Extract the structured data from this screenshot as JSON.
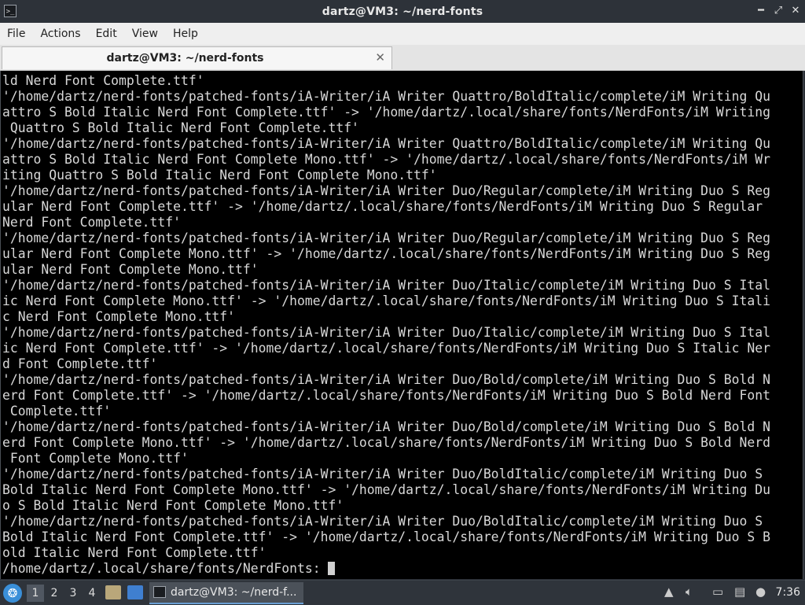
{
  "window": {
    "title": "dartz@VM3: ~/nerd-fonts",
    "controls": {
      "minimize": "━",
      "restore": "⤢",
      "close": "✕"
    },
    "app_icon": ">_"
  },
  "menu": [
    "File",
    "Actions",
    "Edit",
    "View",
    "Help"
  ],
  "tab": {
    "label": "dartz@VM3: ~/nerd-fonts",
    "close": "✕"
  },
  "terminal": {
    "lines": [
      "ld Nerd Font Complete.ttf'",
      "'/home/dartz/nerd-fonts/patched-fonts/iA-Writer/iA Writer Quattro/BoldItalic/complete/iM Writing Qu",
      "attro S Bold Italic Nerd Font Complete.ttf' -> '/home/dartz/.local/share/fonts/NerdFonts/iM Writing",
      " Quattro S Bold Italic Nerd Font Complete.ttf'",
      "'/home/dartz/nerd-fonts/patched-fonts/iA-Writer/iA Writer Quattro/BoldItalic/complete/iM Writing Qu",
      "attro S Bold Italic Nerd Font Complete Mono.ttf' -> '/home/dartz/.local/share/fonts/NerdFonts/iM Wr",
      "iting Quattro S Bold Italic Nerd Font Complete Mono.ttf'",
      "'/home/dartz/nerd-fonts/patched-fonts/iA-Writer/iA Writer Duo/Regular/complete/iM Writing Duo S Reg",
      "ular Nerd Font Complete.ttf' -> '/home/dartz/.local/share/fonts/NerdFonts/iM Writing Duo S Regular ",
      "Nerd Font Complete.ttf'",
      "'/home/dartz/nerd-fonts/patched-fonts/iA-Writer/iA Writer Duo/Regular/complete/iM Writing Duo S Reg",
      "ular Nerd Font Complete Mono.ttf' -> '/home/dartz/.local/share/fonts/NerdFonts/iM Writing Duo S Reg",
      "ular Nerd Font Complete Mono.ttf'",
      "'/home/dartz/nerd-fonts/patched-fonts/iA-Writer/iA Writer Duo/Italic/complete/iM Writing Duo S Ital",
      "ic Nerd Font Complete Mono.ttf' -> '/home/dartz/.local/share/fonts/NerdFonts/iM Writing Duo S Itali",
      "c Nerd Font Complete Mono.ttf'",
      "'/home/dartz/nerd-fonts/patched-fonts/iA-Writer/iA Writer Duo/Italic/complete/iM Writing Duo S Ital",
      "ic Nerd Font Complete.ttf' -> '/home/dartz/.local/share/fonts/NerdFonts/iM Writing Duo S Italic Ner",
      "d Font Complete.ttf'",
      "'/home/dartz/nerd-fonts/patched-fonts/iA-Writer/iA Writer Duo/Bold/complete/iM Writing Duo S Bold N",
      "erd Font Complete.ttf' -> '/home/dartz/.local/share/fonts/NerdFonts/iM Writing Duo S Bold Nerd Font",
      " Complete.ttf'",
      "'/home/dartz/nerd-fonts/patched-fonts/iA-Writer/iA Writer Duo/Bold/complete/iM Writing Duo S Bold N",
      "erd Font Complete Mono.ttf' -> '/home/dartz/.local/share/fonts/NerdFonts/iM Writing Duo S Bold Nerd",
      " Font Complete Mono.ttf'",
      "'/home/dartz/nerd-fonts/patched-fonts/iA-Writer/iA Writer Duo/BoldItalic/complete/iM Writing Duo S ",
      "Bold Italic Nerd Font Complete Mono.ttf' -> '/home/dartz/.local/share/fonts/NerdFonts/iM Writing Du",
      "o S Bold Italic Nerd Font Complete Mono.ttf'",
      "'/home/dartz/nerd-fonts/patched-fonts/iA-Writer/iA Writer Duo/BoldItalic/complete/iM Writing Duo S ",
      "Bold Italic Nerd Font Complete.ttf' -> '/home/dartz/.local/share/fonts/NerdFonts/iM Writing Duo S B",
      "old Italic Nerd Font Complete.ttf'"
    ],
    "prompt": "/home/dartz/.local/share/fonts/NerdFonts: "
  },
  "taskbar": {
    "workspaces": [
      "1",
      "2",
      "3",
      "4"
    ],
    "active_workspace": "1",
    "task_label": "dartz@VM3: ~/nerd-f...",
    "clock": "7:36",
    "icons": [
      "start-menu-icon",
      "file-manager-icon",
      "desktop-icon",
      "terminal-icon",
      "network-icon",
      "volume-icon",
      "display-icon",
      "clipboard-icon",
      "notification-icon"
    ]
  }
}
